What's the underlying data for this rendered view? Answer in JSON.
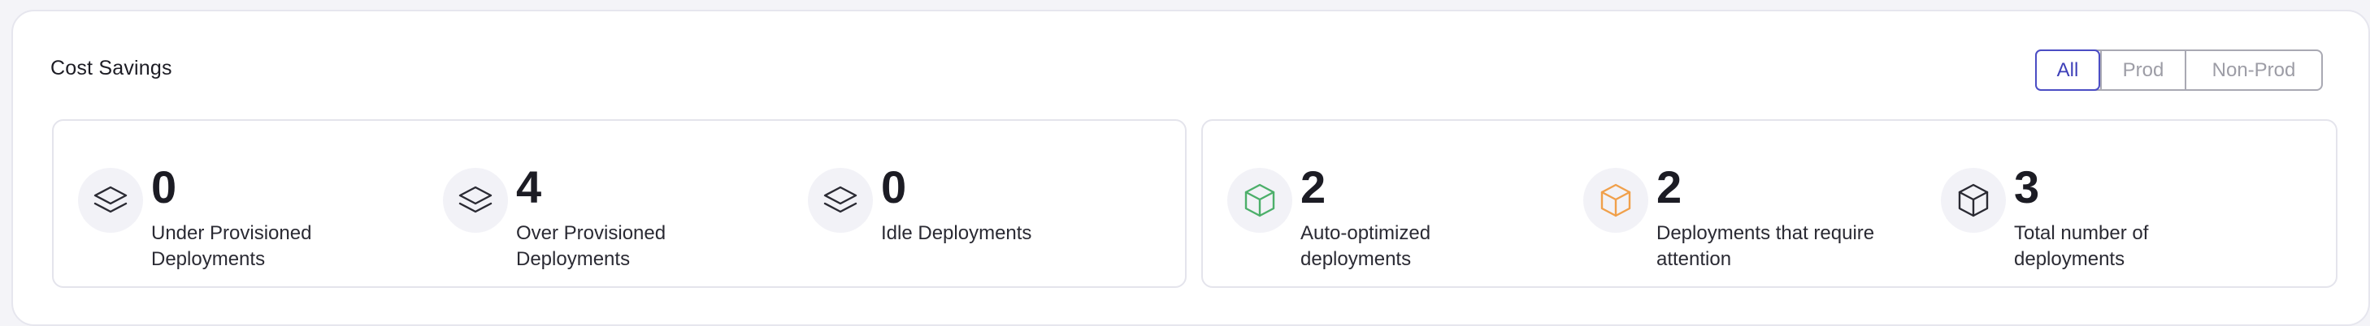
{
  "panel": {
    "title": "Cost Savings"
  },
  "filters": {
    "options": [
      "All",
      "Prod",
      "Non-Prod"
    ],
    "selected": "All",
    "accent_color": "#4b4dc4"
  },
  "provisioning_card": {
    "stats": [
      {
        "value": "0",
        "label": "Under Provisioned Deployments",
        "icon": "layers-icon",
        "icon_color": "#2a2a33"
      },
      {
        "value": "4",
        "label": "Over Provisioned Deployments",
        "icon": "layers-icon",
        "icon_color": "#2a2a33"
      },
      {
        "value": "0",
        "label": "Idle Deployments",
        "icon": "layers-icon",
        "icon_color": "#2a2a33"
      }
    ]
  },
  "optimization_card": {
    "stats": [
      {
        "value": "2",
        "label": "Auto-optimized deployments",
        "icon": "cube-icon",
        "icon_color": "#4caf6a"
      },
      {
        "value": "2",
        "label": "Deployments that require attention",
        "icon": "cube-icon",
        "icon_color": "#f0a04b"
      },
      {
        "value": "3",
        "label": "Total number of deployments",
        "icon": "cube-icon",
        "icon_color": "#2a2a33"
      }
    ]
  }
}
